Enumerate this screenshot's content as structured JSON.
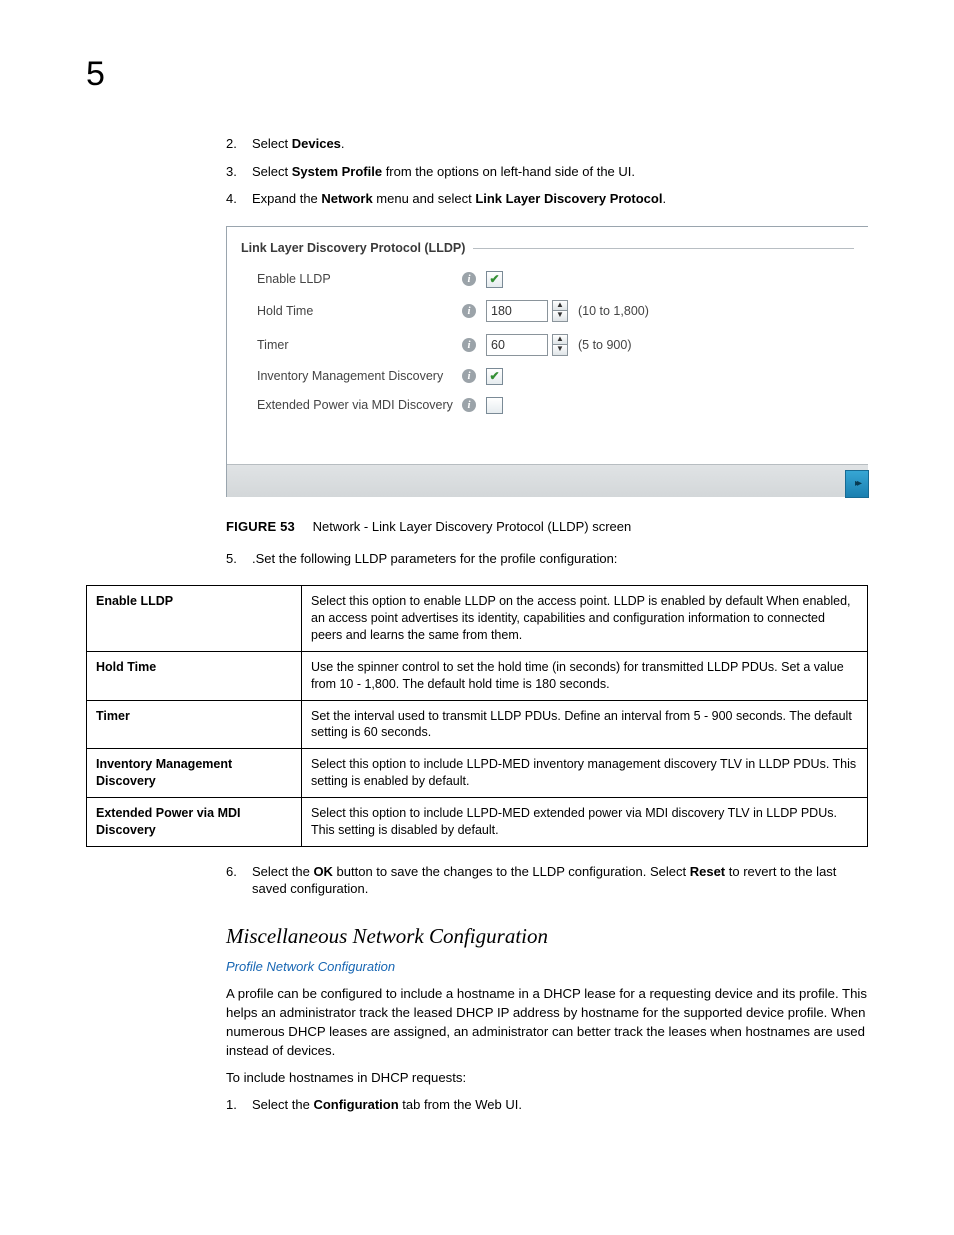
{
  "page_number": "5",
  "steps_top": [
    {
      "num": "2.",
      "pre": "Select ",
      "bold": "Devices",
      "post": "."
    },
    {
      "num": "3.",
      "pre": "Select ",
      "bold": "System Profile",
      "post": " from the options on left-hand side of the UI."
    },
    {
      "num": "4.",
      "pre": "Expand the ",
      "bold": "Network",
      "mid": " menu and select ",
      "bold2": "Link Layer Discovery Protocol",
      "post2": "."
    }
  ],
  "form": {
    "title": "Link Layer Discovery Protocol (LLDP)",
    "rows": {
      "enable": {
        "label": "Enable LLDP",
        "checked": true
      },
      "hold": {
        "label": "Hold Time",
        "value": "180",
        "hint": "(10 to 1,800)"
      },
      "timer": {
        "label": "Timer",
        "value": "60",
        "hint": "(5 to 900)"
      },
      "imd": {
        "label": "Inventory Management Discovery",
        "checked": true
      },
      "epmdi": {
        "label": "Extended Power via MDI Discovery",
        "checked": false
      }
    }
  },
  "figure": {
    "label": "FIGURE 53",
    "caption": "Network - Link Layer Discovery Protocol (LLDP) screen"
  },
  "step5": {
    "num": "5.",
    "text": ".Set the following LLDP parameters for the profile configuration:"
  },
  "table": [
    {
      "param": "Enable LLDP",
      "desc": "Select this option to enable LLDP on the access point. LLDP is enabled by default When enabled, an access point advertises its identity, capabilities and configuration information to connected peers and learns the same from them."
    },
    {
      "param": "Hold Time",
      "desc": "Use the spinner control to set the hold time (in seconds) for transmitted LLDP PDUs. Set a value from 10 - 1,800. The default hold time is 180 seconds."
    },
    {
      "param": "Timer",
      "desc": "Set the interval used to transmit LLDP PDUs. Define an interval from 5 - 900 seconds. The default setting is 60 seconds."
    },
    {
      "param": "Inventory Management Discovery",
      "desc": "Select this option to include LLPD-MED inventory management discovery TLV in LLDP PDUs. This setting is enabled by default."
    },
    {
      "param": "Extended Power via MDI Discovery",
      "desc": "Select this option to include LLPD-MED extended power via MDI discovery TLV in LLDP PDUs. This setting is disabled by default."
    }
  ],
  "step6": {
    "num": "6.",
    "pre": "Select the ",
    "b1": "OK",
    "mid": " button to save the changes to the LLDP configuration. Select ",
    "b2": "Reset",
    "post": " to revert to the last saved configuration."
  },
  "section": "Miscellaneous Network Configuration",
  "link": "Profile Network Configuration",
  "para": "A profile can be configured to include a hostname in a DHCP lease for a requesting device and its profile. This helps an administrator track the leased DHCP IP address by hostname for the supported device profile. When numerous DHCP leases are assigned, an administrator can better track the leases when hostnames are used instead of devices.",
  "para2": "To include hostnames in DHCP requests:",
  "step_bottom": {
    "num": "1.",
    "pre": "Select the ",
    "bold": "Configuration",
    "post": " tab from the Web UI."
  }
}
